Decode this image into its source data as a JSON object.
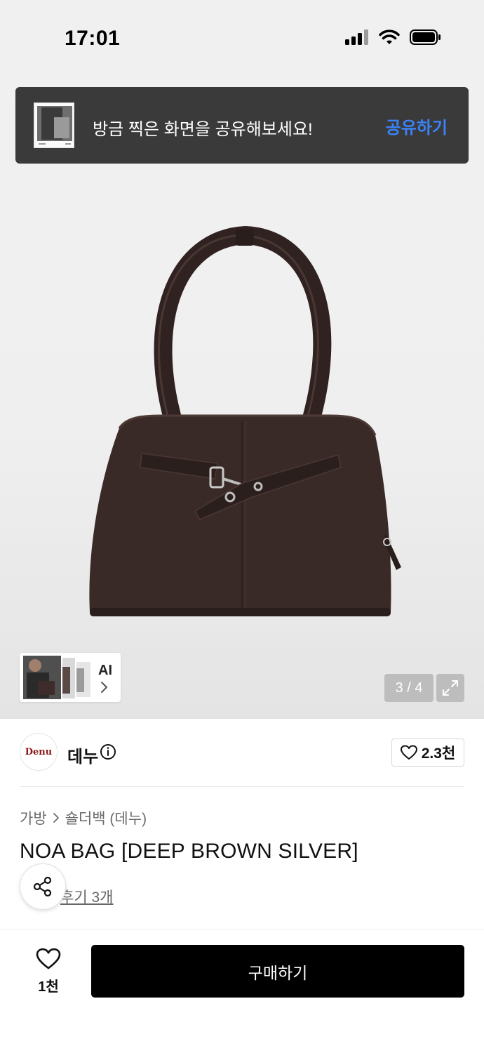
{
  "status_bar": {
    "time": "17:01"
  },
  "toast": {
    "message": "방금 찍은 화면을 공유해보세요!",
    "action": "공유하기"
  },
  "gallery": {
    "ai_label": "AI",
    "page_indicator": "3 / 4"
  },
  "brand": {
    "logo_text": "Denu",
    "name": "데누",
    "like_count": "2.3천"
  },
  "breadcrumb": {
    "category": "가방",
    "subcategory": "숄더백 (데누)"
  },
  "product": {
    "title": "NOA BAG [DEEP BROWN SILVER]",
    "review_text": "후기 3개"
  },
  "bottom_bar": {
    "like_count": "1천",
    "buy_label": "구매하기"
  },
  "colors": {
    "accent_blue": "#3b82f6",
    "bag_brown": "#3b2b28",
    "buy_button": "#000000"
  }
}
